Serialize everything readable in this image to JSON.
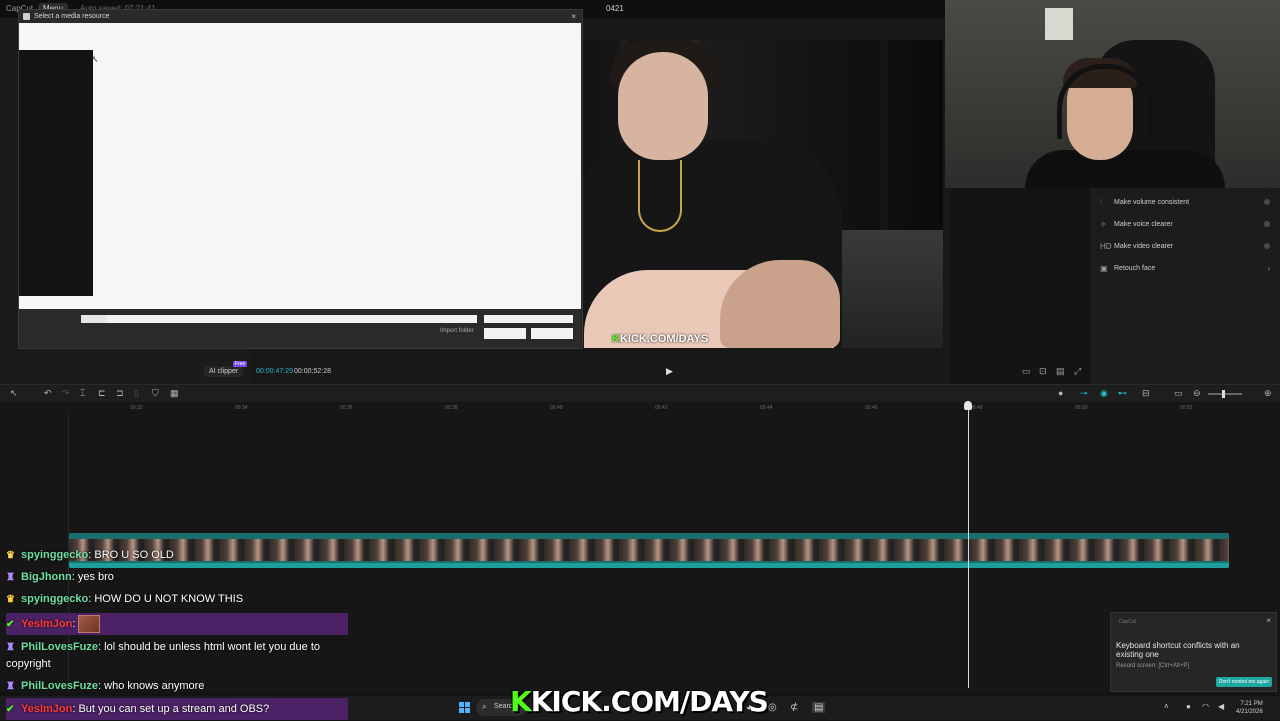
{
  "app": {
    "title": "CapCut",
    "menu_label": "Menu",
    "autosave": "Auto saved: 07:21:41",
    "project_name": "0421"
  },
  "dialog": {
    "title": "Select a media resource",
    "close_glyph": "×",
    "import_folder": "Import folder"
  },
  "player": {
    "ai_clipper": "AI clipper",
    "ai_clipper_badge": "Free",
    "time_current": "00:00:47:29",
    "time_total": "00:00:52:28",
    "overlay": "KICK.COM/DAYS",
    "overlay_k": "K"
  },
  "right_panel": {
    "items": [
      {
        "label": "Make volume consistent",
        "icon": "volume-icon"
      },
      {
        "label": "Make voice clearer",
        "icon": "voice-icon"
      },
      {
        "label": "Make video clearer",
        "icon": "hd-icon",
        "glyph": "HD"
      },
      {
        "label": "Retouch face",
        "icon": "retouch-icon"
      }
    ]
  },
  "timeline": {
    "ticks": [
      "00:32",
      "00:34",
      "00:36",
      "00:38",
      "00:40",
      "00:42",
      "00:44",
      "00:46",
      "00:48",
      "00:50",
      "00:52"
    ],
    "accent": "#1fc3c9"
  },
  "chat": [
    {
      "user": "spyinggecko",
      "message": ": BRO U SO OLD",
      "badge": "crown"
    },
    {
      "user": "BigJhonn",
      "message": ": yes bro",
      "badge": "sub"
    },
    {
      "user": "spyinggecko",
      "message": ": HOW DO U NOT KNOW THIS",
      "badge": "crown"
    },
    {
      "user": "YesImJon",
      "message": ":",
      "badge": "verified"
    },
    {
      "user": "PhilLovesFuze",
      "message": ": lol should be unless html wont let you due to copyright",
      "badge": "sub"
    },
    {
      "user": "PhilLovesFuze",
      "message": ": who knows anymore",
      "badge": "sub"
    },
    {
      "user": "YesImJon",
      "message": ": But you can set up a stream and OBS?",
      "badge": "verified"
    }
  ],
  "notification": {
    "app": "CapCut",
    "message": "Keyboard shortcut conflicts with an existing one",
    "sub": "Record screen: [Ctrl+Alt+P]",
    "button": "Don't remind me again",
    "close_glyph": "×"
  },
  "taskbar": {
    "search": "Search",
    "time": "7:21 PM",
    "date": "4/21/2026",
    "overlay": "KICK.COM/DAYS",
    "overlay_k": "K"
  },
  "colors": {
    "kick_green": "#53fc18",
    "teal": "#1fc3c9",
    "chat_highlight": "#4b2266"
  }
}
